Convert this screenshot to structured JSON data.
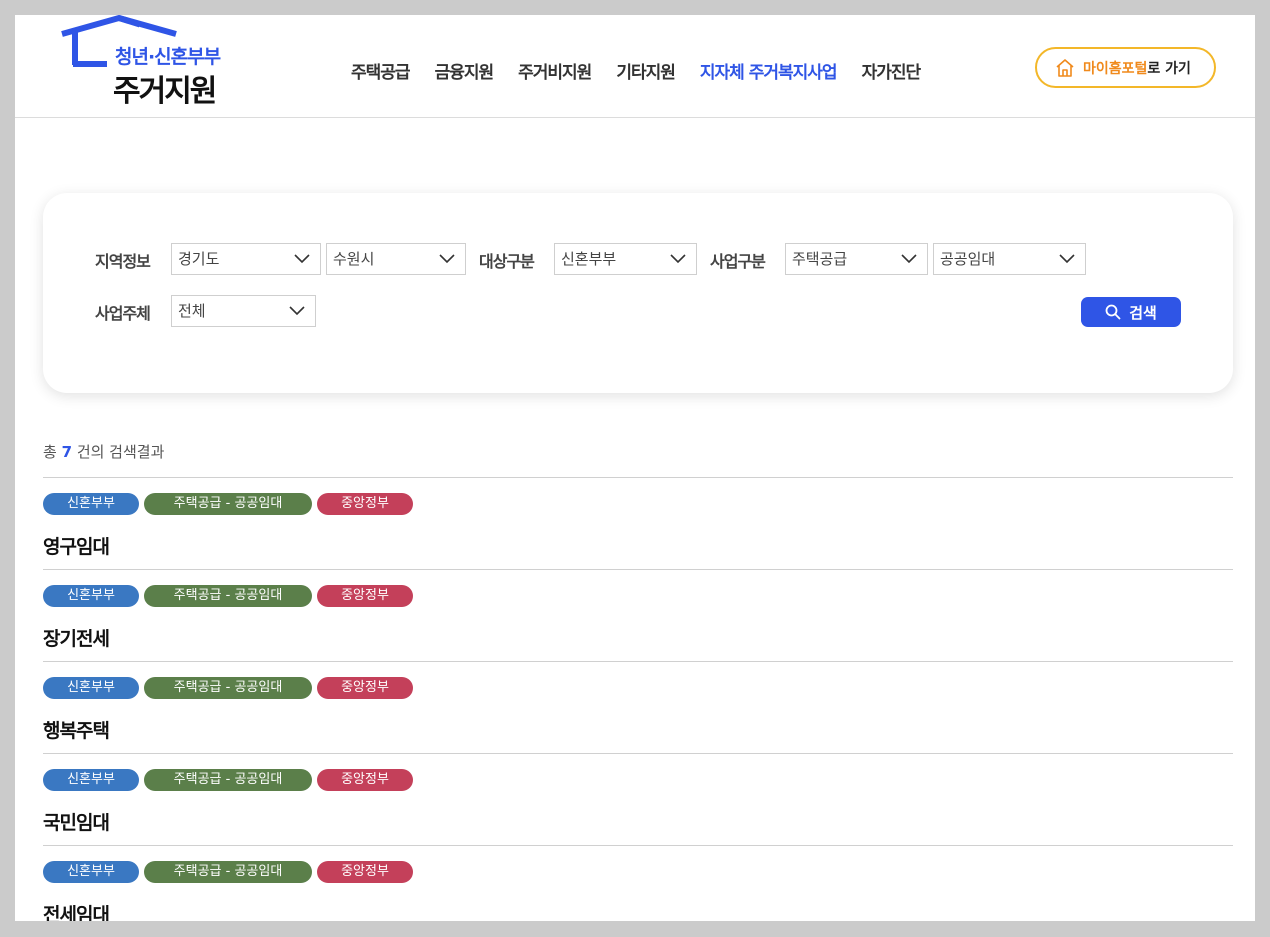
{
  "header": {
    "logo_sub": "청년·신혼부부",
    "logo_main": "주거지원",
    "nav": [
      {
        "label": "주택공급",
        "active": false
      },
      {
        "label": "금융지원",
        "active": false
      },
      {
        "label": "주거비지원",
        "active": false
      },
      {
        "label": "기타지원",
        "active": false
      },
      {
        "label": "지자체 주거복지사업",
        "active": true
      },
      {
        "label": "자가진단",
        "active": false
      }
    ],
    "portal_accent": "마이홈포털",
    "portal_rest": "로 가기"
  },
  "search": {
    "region_label": "지역정보",
    "region_province": "경기도",
    "region_city": "수원시",
    "target_label": "대상구분",
    "target_value": "신혼부부",
    "biz_label": "사업구분",
    "biz_type": "주택공급",
    "biz_subtype": "공공임대",
    "org_label": "사업주체",
    "org_value": "전체",
    "search_button": "검색"
  },
  "results": {
    "prefix": "총",
    "count": "7",
    "suffix": "건의 검색결과",
    "items": [
      {
        "target": "신혼부부",
        "biz": "주택공급 - 공공임대",
        "org": "중앙정부",
        "title": "영구임대"
      },
      {
        "target": "신혼부부",
        "biz": "주택공급 - 공공임대",
        "org": "중앙정부",
        "title": "장기전세"
      },
      {
        "target": "신혼부부",
        "biz": "주택공급 - 공공임대",
        "org": "중앙정부",
        "title": "행복주택"
      },
      {
        "target": "신혼부부",
        "biz": "주택공급 - 공공임대",
        "org": "중앙정부",
        "title": "국민임대"
      },
      {
        "target": "신혼부부",
        "biz": "주택공급 - 공공임대",
        "org": "중앙정부",
        "title": "전세임대"
      }
    ]
  },
  "colors": {
    "brand_blue": "#2f55e6",
    "portal_border": "#f3b729",
    "tag_target": "#3a78c2",
    "tag_biz": "#5b7f4a",
    "tag_org": "#c4405a"
  }
}
